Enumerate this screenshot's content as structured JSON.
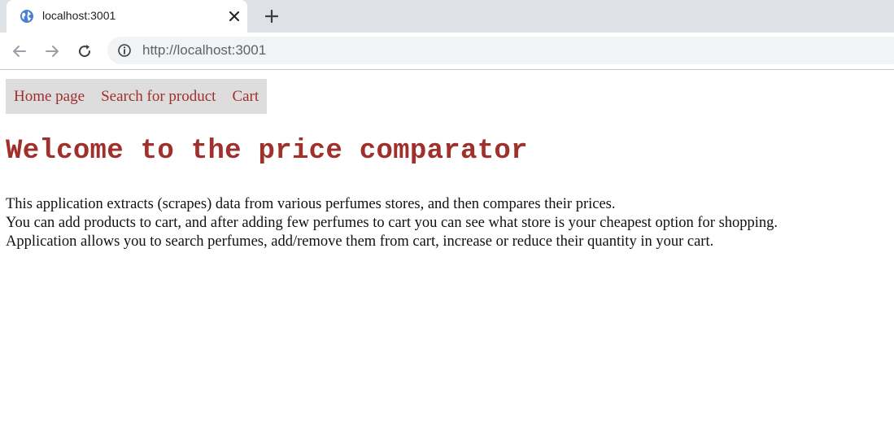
{
  "browser": {
    "tab_title": "localhost:3001",
    "address": "http://localhost:3001"
  },
  "nav": {
    "home": "Home page",
    "search": "Search for product",
    "cart": "Cart"
  },
  "main": {
    "title": "Welcome to the price comparator",
    "paragraphs": [
      "This application extracts (scrapes) data from various perfumes stores, and then compares their prices.",
      "You can add products to cart, and after adding few perfumes to cart you can see what store is your cheapest option for shopping.",
      "Application allows you to search perfumes, add/remove them from cart, increase or reduce their quantity in your cart."
    ]
  },
  "colors": {
    "accent": "#a0302c",
    "navbar_bg": "#dddddd",
    "tabstrip_bg": "#dee1e6",
    "omnibox_bg": "#f1f3f4"
  },
  "icons": {
    "favicon": "globe-icon",
    "close": "close-icon",
    "new_tab": "plus-icon",
    "back": "back-arrow-icon",
    "forward": "forward-arrow-icon",
    "reload": "reload-icon",
    "site_info": "info-icon"
  }
}
